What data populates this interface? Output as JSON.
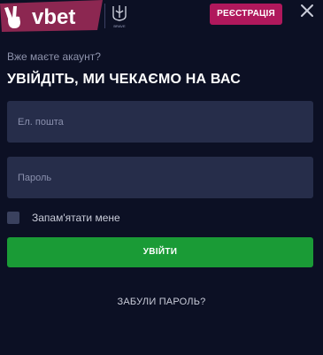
{
  "header": {
    "logo_text": "vbet",
    "emblem_caption": "BRAVE",
    "register_label": "РЕЄСТРАЦІЯ",
    "close_icon": "close-icon"
  },
  "login": {
    "subtitle": "Вже маєте акаунт?",
    "title": "УВІЙДІТЬ, МИ ЧЕКАЄМО НА ВАС",
    "email_placeholder": "Ел. пошта",
    "email_value": "",
    "password_placeholder": "Пароль",
    "password_value": "",
    "remember_label": "Запам'ятати мене",
    "remember_checked": false,
    "submit_label": "УВІЙТИ",
    "forgot_label": "ЗАБУЛИ ПАРОЛЬ?"
  },
  "colors": {
    "background": "#0c1024",
    "input_background": "#262d4a",
    "register_accent": "#b0185c",
    "submit_accent": "#1a9b36",
    "logo_accent": "#8c2751"
  }
}
